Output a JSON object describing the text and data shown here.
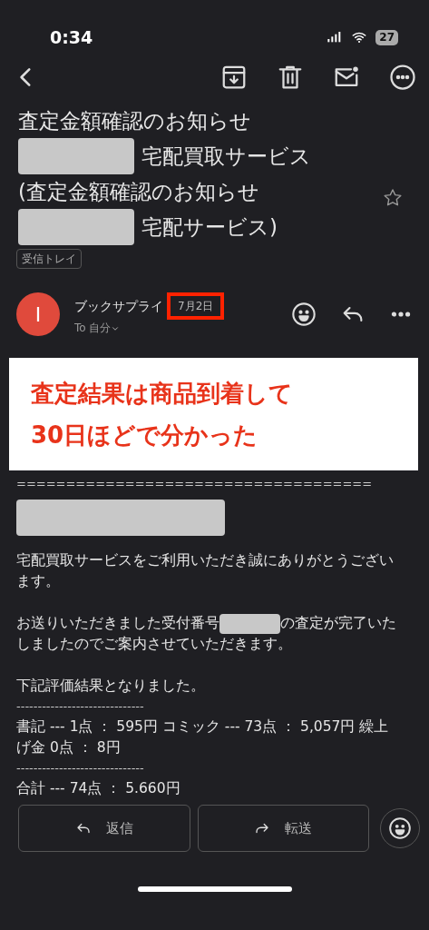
{
  "status_bar": {
    "time": "0:34",
    "battery": "27"
  },
  "subject_lines": [
    {
      "redacted": false,
      "text": "査定金額確認のお知らせ"
    },
    {
      "redacted": true,
      "text": "宅配買取サービス"
    },
    {
      "redacted": false,
      "text": "(査定金額確認のお知らせ"
    },
    {
      "redacted": true,
      "text": "宅配サービス)"
    }
  ],
  "starred": false,
  "label": "受信トレイ",
  "sender": {
    "initial": "I",
    "name": "ブックサプライ",
    "date": "7月2日",
    "to": "To 自分"
  },
  "annotation": {
    "lines": [
      "査定結果は商品到着して",
      "30日ほどで分かった"
    ]
  },
  "body": [
    {
      "kind": "rule",
      "text": "===================================="
    },
    {
      "kind": "redaction"
    },
    {
      "kind": "text",
      "text": "宅配買取サービスをご利用いただき誠にありがとうございます。"
    },
    {
      "kind": "split",
      "before": "お送りいただきました受付番号",
      "after": "の査定が完了いた",
      "next_line": "しましたのでご案内させていただきます。"
    },
    {
      "kind": "text",
      "text": "下記評価結果となりました。"
    },
    {
      "kind": "rule",
      "text": "------------------------------"
    },
    {
      "kind": "text",
      "text": "書記 --- 1点 ： 595円 コミック --- 73点 ： 5,057円 繰上げ金 0点 ： 8円"
    },
    {
      "kind": "rule",
      "text": "------------------------------"
    },
    {
      "kind": "text",
      "text": "合計 --- 74点 ： 5.660円"
    }
  ],
  "actions": [
    {
      "kind": "reply",
      "label": "返信"
    },
    {
      "kind": "forward",
      "label": "転送"
    }
  ]
}
